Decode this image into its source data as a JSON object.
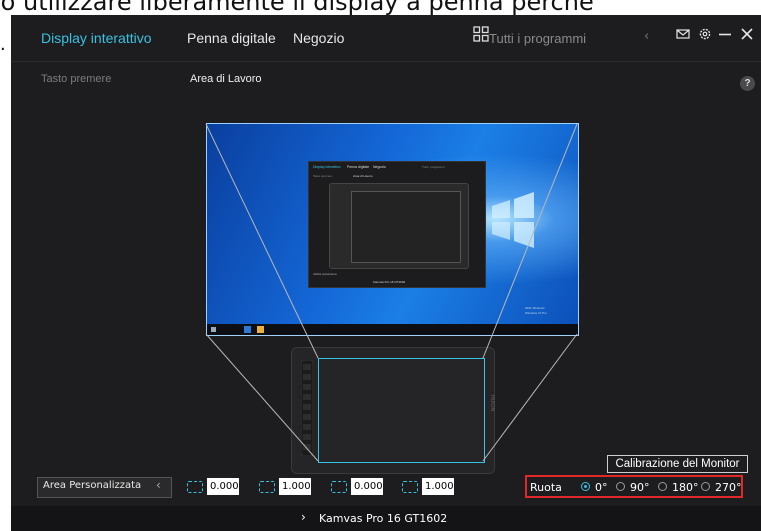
{
  "caption": {
    "text": "lo utilizzare liberamente il display a penna perché",
    "bullet": "."
  },
  "nav": {
    "tabs": [
      {
        "label": "Display interattivo",
        "active": true
      },
      {
        "label": "Penna digitale",
        "active": false
      },
      {
        "label": "Negozio",
        "active": false
      }
    ],
    "search_placeholder": "Tutti i programmi",
    "icons": [
      "grid-icon",
      "chevron-left-icon",
      "mail-icon",
      "gear-icon",
      "minimize-icon",
      "close-icon"
    ]
  },
  "subnav": {
    "items": [
      {
        "label": "Tasto premere",
        "active": false
      },
      {
        "label": "Area di Lavoro",
        "active": true
      }
    ],
    "help": "?"
  },
  "mini_screenshot": {
    "tabs": [
      "Display interattivo",
      "Penna digitale",
      "Negozio"
    ],
    "search": "Tutti i programmi",
    "subnav": [
      "Tasto premere",
      "Area di Lavoro"
    ],
    "checkbox": "Abilita pulsantiera",
    "device": "Kamvas Pro 16 GT1602",
    "watermark_line1": "2021 Windows",
    "watermark_line2": "Windows 10 Pro"
  },
  "tablet": {
    "brand": "HUION"
  },
  "calibration_button": "Calibrazione del Monitor",
  "area": {
    "select_label": "Area Personalizzata",
    "values": [
      "0.000",
      "1.000",
      "0.000",
      "1.000"
    ]
  },
  "rotation": {
    "label": "Ruota",
    "options": [
      "0°",
      "90°",
      "180°",
      "270°"
    ],
    "selected": "0°"
  },
  "footer": {
    "device_name": "Kamvas Pro 16 GT1602"
  },
  "colors": {
    "accent": "#39c1e2",
    "background": "#1d1d1f",
    "highlight_border": "#e02828"
  }
}
